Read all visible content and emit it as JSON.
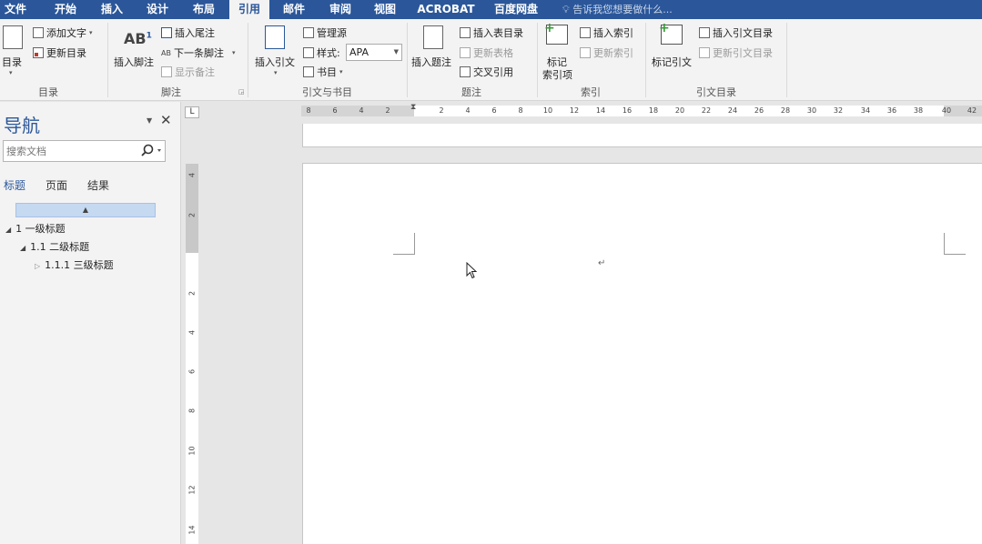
{
  "menu": {
    "tabs": [
      "文件",
      "开始",
      "插入",
      "设计",
      "布局",
      "引用",
      "邮件",
      "审阅",
      "视图",
      "ACROBAT",
      "百度网盘"
    ],
    "active": "引用",
    "tell_me": "告诉我您想要做什么..."
  },
  "ribbon": {
    "toc": {
      "big": "目录",
      "add_text": "添加文字",
      "update": "更新目录",
      "group": "目录"
    },
    "footnotes": {
      "insert_footnote": "插入脚注",
      "insert_endnote": "插入尾注",
      "next_footnote": "下一条脚注",
      "show_notes": "显示备注",
      "group": "脚注"
    },
    "citations": {
      "insert_citation": "插入引文",
      "manage_sources": "管理源",
      "style_label": "样式:",
      "style_value": "APA",
      "bibliography": "书目",
      "group": "引文与书目"
    },
    "captions": {
      "insert_caption": "插入题注",
      "insert_table_of_figures": "插入表目录",
      "update_table": "更新表格",
      "cross_reference": "交叉引用",
      "group": "题注"
    },
    "index": {
      "mark_entry_1": "标记",
      "mark_entry_2": "索引项",
      "insert_index": "插入索引",
      "update_index": "更新索引",
      "group": "索引"
    },
    "toa": {
      "mark_citation": "标记引文",
      "insert_toa": "插入引文目录",
      "update_toa": "更新引文目录",
      "group": "引文目录"
    }
  },
  "nav": {
    "title": "导航",
    "search_placeholder": "搜索文档",
    "tabs": [
      "标题",
      "页面",
      "结果"
    ],
    "active_tab": "标题",
    "headings": [
      {
        "text": "1 一级标题",
        "level": 1,
        "expanded": true
      },
      {
        "text": "1.1 二级标题",
        "level": 2,
        "expanded": true
      },
      {
        "text": "1.1.1 三级标题",
        "level": 3,
        "expanded": false
      }
    ]
  },
  "ruler": {
    "corner": "L",
    "h_ticks": [
      "8",
      "6",
      "4",
      "2",
      "2",
      "4",
      "6",
      "8",
      "10",
      "12",
      "14",
      "16",
      "18",
      "20",
      "22",
      "24",
      "26",
      "28",
      "30",
      "32",
      "34",
      "36",
      "38",
      "40",
      "42"
    ],
    "v_ticks": [
      "4",
      "2",
      "2",
      "4",
      "6",
      "8",
      "10",
      "12",
      "14"
    ]
  },
  "document": {
    "paragraph_mark": "↵"
  }
}
